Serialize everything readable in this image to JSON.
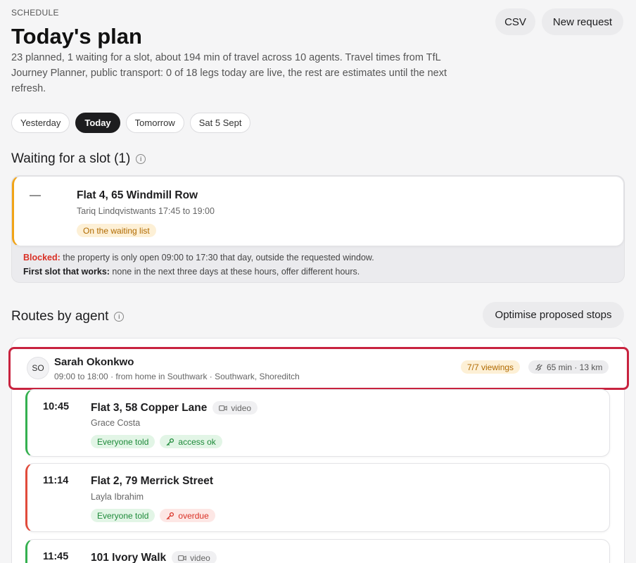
{
  "header": {
    "eyebrow": "SCHEDULE",
    "title": "Today's plan",
    "subtitle": "23 planned, 1 waiting for a slot, about 194 min of travel across 10 agents. Travel times from TfL Journey Planner, public transport: 0 of 18 legs today are live, the rest are estimates until the next refresh.",
    "csv_label": "CSV",
    "new_request_label": "New request"
  },
  "day_tabs": [
    {
      "label": "Yesterday",
      "active": false
    },
    {
      "label": "Today",
      "active": true
    },
    {
      "label": "Tomorrow",
      "active": false
    },
    {
      "label": "Sat 5 Sept",
      "active": false
    }
  ],
  "waiting": {
    "title": "Waiting for a slot (1)",
    "card": {
      "dash": "—",
      "address": "Flat 4, 65 Windmill Row",
      "detail": "Tariq Lindqvistwants 17:45 to 19:00",
      "status": "On the waiting list"
    },
    "blocked_label": "Blocked:",
    "blocked_text": " the property is only open 09:00 to 17:30 that day, outside the requested window.",
    "first_slot_label": "First slot that works:",
    "first_slot_text": " none in the next three days at these hours, offer different hours."
  },
  "routes": {
    "title": "Routes by agent",
    "optimise_label": "Optimise proposed stops",
    "agent": {
      "initials": "SO",
      "name": "Sarah Okonkwo",
      "meta": "09:00 to 18:00 · from home in Southwark · Southwark, Shoreditch",
      "viewings": "7/7 viewings",
      "travel": "65 min · 13 km"
    },
    "stops": [
      {
        "time": "10:45",
        "address": "Flat 3, 58 Copper Lane",
        "video": "video",
        "person": "Grace Costa",
        "told": "Everyone told",
        "access": "access ok",
        "status_color": "#34b04f"
      },
      {
        "time": "11:14",
        "address": "Flat 2, 79 Merrick Street",
        "person": "Layla Ibrahim",
        "told": "Everyone told",
        "access": "overdue",
        "status_color": "#e14b3b"
      },
      {
        "time": "11:45",
        "address": "101 Ivory Walk",
        "video": "video",
        "status_color": "#34b04f"
      }
    ]
  },
  "icons": {
    "info": "info-icon",
    "video": "video-icon",
    "key": "key-icon",
    "route": "route-icon"
  }
}
